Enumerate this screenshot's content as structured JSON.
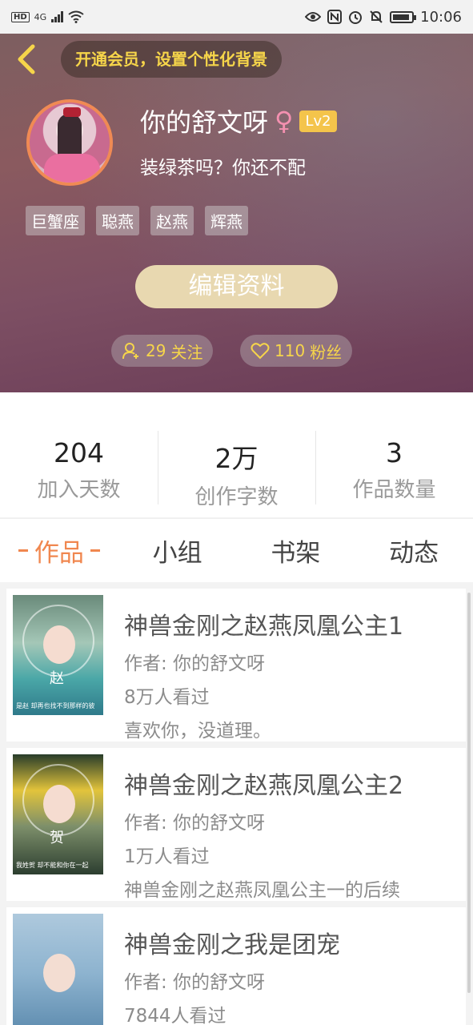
{
  "status_bar": {
    "left_tags": [
      "HD",
      "4G"
    ],
    "time": "10:06"
  },
  "header": {
    "vip_text": "开通会员，设置个性化背景",
    "name": "你的舒文呀",
    "gender_symbol": "♀",
    "level": "Lv2",
    "bio": "装绿茶吗？你还不配",
    "tags": [
      "巨蟹座",
      "聪燕",
      "赵燕",
      "辉燕"
    ],
    "edit_label": "编辑资料",
    "follow": {
      "count": "29",
      "label": "关注"
    },
    "fans": {
      "count": "110",
      "label": "粉丝"
    }
  },
  "stats": [
    {
      "value": "204",
      "label": "加入天数"
    },
    {
      "value": "2万",
      "label": "创作字数"
    },
    {
      "value": "3",
      "label": "作品数量"
    }
  ],
  "tabs": [
    "作品",
    "小组",
    "书架",
    "动态"
  ],
  "works": [
    {
      "title": "神兽金刚之赵燕凤凰公主1",
      "author": "作者: 你的舒文呀",
      "views": "8万人看过",
      "desc": "喜欢你，没道理。",
      "cover_char": "赵",
      "cover_caption": "是赵 却再也找不到那样的彼"
    },
    {
      "title": "神兽金刚之赵燕凤凰公主2",
      "author": "作者: 你的舒文呀",
      "views": "1万人看过",
      "desc": "神兽金刚之赵燕凤凰公主一的后续",
      "cover_char": "贺",
      "cover_caption": "我姓贺 却不能和你在一起"
    },
    {
      "title": "神兽金刚之我是团宠",
      "author": "作者: 你的舒文呀",
      "views": "7844人看过",
      "desc": "",
      "cover_char": "",
      "cover_caption": ""
    }
  ]
}
